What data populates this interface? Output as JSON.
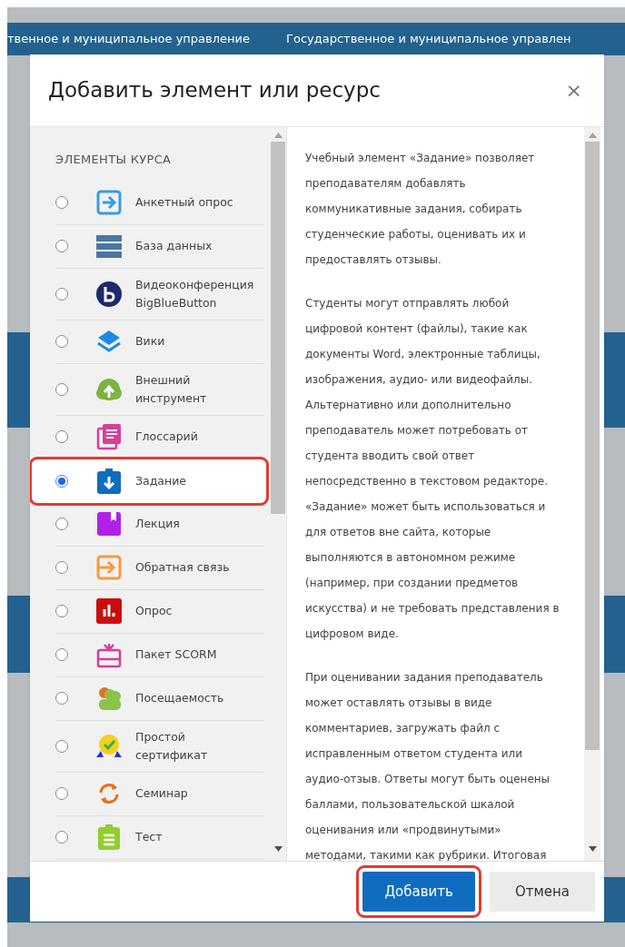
{
  "breadcrumb": [
    "твенное и муниципальное управление",
    "Государственное и муниципальное управлен"
  ],
  "dialog": {
    "title": "Добавить элемент или ресурс",
    "close": "×",
    "section_title": "ЭЛЕМЕНТЫ КУРСА",
    "items": [
      {
        "label": "Анкетный опрос",
        "selected": false
      },
      {
        "label": "База данных",
        "selected": false
      },
      {
        "label": "Видеоконференция BigBlueButton",
        "selected": false
      },
      {
        "label": "Вики",
        "selected": false
      },
      {
        "label": "Внешний инструмент",
        "selected": false
      },
      {
        "label": "Глоссарий",
        "selected": false
      },
      {
        "label": "Задание",
        "selected": true
      },
      {
        "label": "Лекция",
        "selected": false
      },
      {
        "label": "Обратная связь",
        "selected": false
      },
      {
        "label": "Опрос",
        "selected": false
      },
      {
        "label": "Пакет SCORM",
        "selected": false
      },
      {
        "label": "Посещаемость",
        "selected": false
      },
      {
        "label": "Простой сертификат",
        "selected": false
      },
      {
        "label": "Семинар",
        "selected": false
      },
      {
        "label": "Тест",
        "selected": false
      }
    ],
    "description": [
      [
        "Учебный элемент «Задание» позволяет",
        "преподавателям добавлять",
        "коммуникативные задания, собирать",
        "студенческие работы, оценивать их и",
        "предоставлять отзывы."
      ],
      [
        "Студенты могут отправлять любой",
        "цифровой контент (файлы), такие как",
        "документы Word, электронные таблицы,",
        "изображения, аудио- или видеофайлы.",
        "Альтернативно или дополнительно",
        "преподаватель может потребовать от",
        "студента вводить свой ответ",
        "непосредственно в текстовом редакторе.",
        "«Задание» может быть использоваться и",
        "для ответов вне сайта, которые",
        "выполняются в автономном режиме",
        "(например, при создании предметов",
        "искусства) и не требовать представления в",
        "цифровом виде."
      ],
      [
        "При оценивании задания преподаватель",
        "может оставлять отзывы в виде",
        "комментариев, загружать файл с",
        "исправленным ответом студента или",
        "аудио-отзыв. Ответы могут быть оценены",
        "баллами, пользовательской шкалой",
        "оценивания или «продвинутыми»",
        "методами, такими как рубрики. Итоговая"
      ]
    ],
    "buttons": [
      {
        "label": "Добавить",
        "kind": "primary"
      },
      {
        "label": "Отмена",
        "kind": "secondary"
      }
    ]
  }
}
